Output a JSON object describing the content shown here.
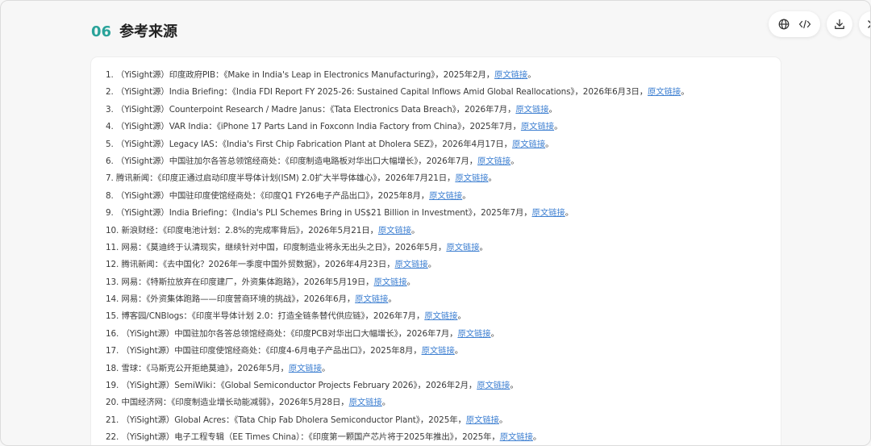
{
  "section": {
    "number": "06",
    "title": "参考来源"
  },
  "toolbar": {
    "icons": [
      "globe-icon",
      "code-icon",
      "download-icon",
      "close-icon"
    ]
  },
  "references": [
    {
      "num": "1.",
      "text": "（YiSight源）印度政府PIB：《Make in India's Leap in Electronics Manufacturing》，2025年2月，",
      "link": "原文链接",
      "end": "。"
    },
    {
      "num": "2.",
      "text": "（YiSight源）India Briefing：《India FDI Report FY 2025-26: Sustained Capital Inflows Amid Global Reallocations》，2026年6月3日，",
      "link": "原文链接",
      "end": "。"
    },
    {
      "num": "3.",
      "text": "（YiSight源）Counterpoint Research / Madre Janus：《Tata Electronics Data Breach》，2026年7月，",
      "link": "原文链接",
      "end": "。"
    },
    {
      "num": "4.",
      "text": "（YiSight源）VAR India：《iPhone 17 Parts Land in Foxconn India Factory from China》，2025年7月，",
      "link": "原文链接",
      "end": "。"
    },
    {
      "num": "5.",
      "text": "（YiSight源）Legacy IAS：《India's First Chip Fabrication Plant at Dholera SEZ》，2026年4月17日，",
      "link": "原文链接",
      "end": "。"
    },
    {
      "num": "6.",
      "text": "（YiSight源）中国驻加尔各答总领馆经商处：《印度制造电路板对华出口大幅增长》，2026年7月，",
      "link": "原文链接",
      "end": "。"
    },
    {
      "num": "7.",
      "text": "腾讯新闻：《印度正通过启动印度半导体计划(ISM) 2.0扩大半导体雄心》，2026年7月21日，",
      "link": "原文链接",
      "end": "。"
    },
    {
      "num": "8.",
      "text": "（YiSight源）中国驻印度使馆经商处：《印度Q1 FY26电子产品出口》，2025年8月，",
      "link": "原文链接",
      "end": "。"
    },
    {
      "num": "9.",
      "text": "（YiSight源）India Briefing：《India's PLI Schemes Bring in US$21 Billion in Investment》，2025年7月，",
      "link": "原文链接",
      "end": "。"
    },
    {
      "num": "10.",
      "text": "新浪财经：《印度电池计划：2.8%的完成率背后》，2026年5月21日，",
      "link": "原文链接",
      "end": "。"
    },
    {
      "num": "11.",
      "text": "网易：《莫迪终于认清现实，继续针对中国，印度制造业将永无出头之日》，2026年5月，",
      "link": "原文链接",
      "end": "。"
    },
    {
      "num": "12.",
      "text": "腾讯新闻：《去中国化？2026年一季度中国外贸数据》，2026年4月23日，",
      "link": "原文链接",
      "end": "。"
    },
    {
      "num": "13.",
      "text": "网易：《特斯拉放弃在印度建厂，外资集体跑路》，2026年5月19日，",
      "link": "原文链接",
      "end": "。"
    },
    {
      "num": "14.",
      "text": "网易：《外资集体跑路——印度营商环境的挑战》，2026年6月，",
      "link": "原文链接",
      "end": "。"
    },
    {
      "num": "15.",
      "text": "博客园/CNBlogs：《印度半导体计划 2.0：打造全链条替代供应链》，2026年7月，",
      "link": "原文链接",
      "end": "。"
    },
    {
      "num": "16.",
      "text": "（YiSight源）中国驻加尔各答总领馆经商处：《印度PCB对华出口大幅增长》，2026年7月，",
      "link": "原文链接",
      "end": "。"
    },
    {
      "num": "17.",
      "text": "（YiSight源）中国驻印度使馆经商处：《印度4-6月电子产品出口》，2025年8月，",
      "link": "原文链接",
      "end": "。"
    },
    {
      "num": "18.",
      "text": "雪球：《马斯克公开拒绝莫迪》，2026年5月，",
      "link": "原文链接",
      "end": "。"
    },
    {
      "num": "19.",
      "text": "（YiSight源）SemiWiki：《Global Semiconductor Projects February 2026》，2026年2月，",
      "link": "原文链接",
      "end": "。"
    },
    {
      "num": "20.",
      "text": "中国经济网：《印度制造业增长动能减弱》，2026年5月28日，",
      "link": "原文链接",
      "end": "。"
    },
    {
      "num": "21.",
      "text": "（YiSight源）Global Acres：《Tata Chip Fab Dholera Semiconductor Plant》，2025年，",
      "link": "原文链接",
      "end": "。"
    },
    {
      "num": "22.",
      "text": "（YiSight源）电子工程专辑（EE Times China）：《印度第一颗国产芯片将于2025年推出》，2025年，",
      "link": "原文链接",
      "end": "。"
    }
  ]
}
